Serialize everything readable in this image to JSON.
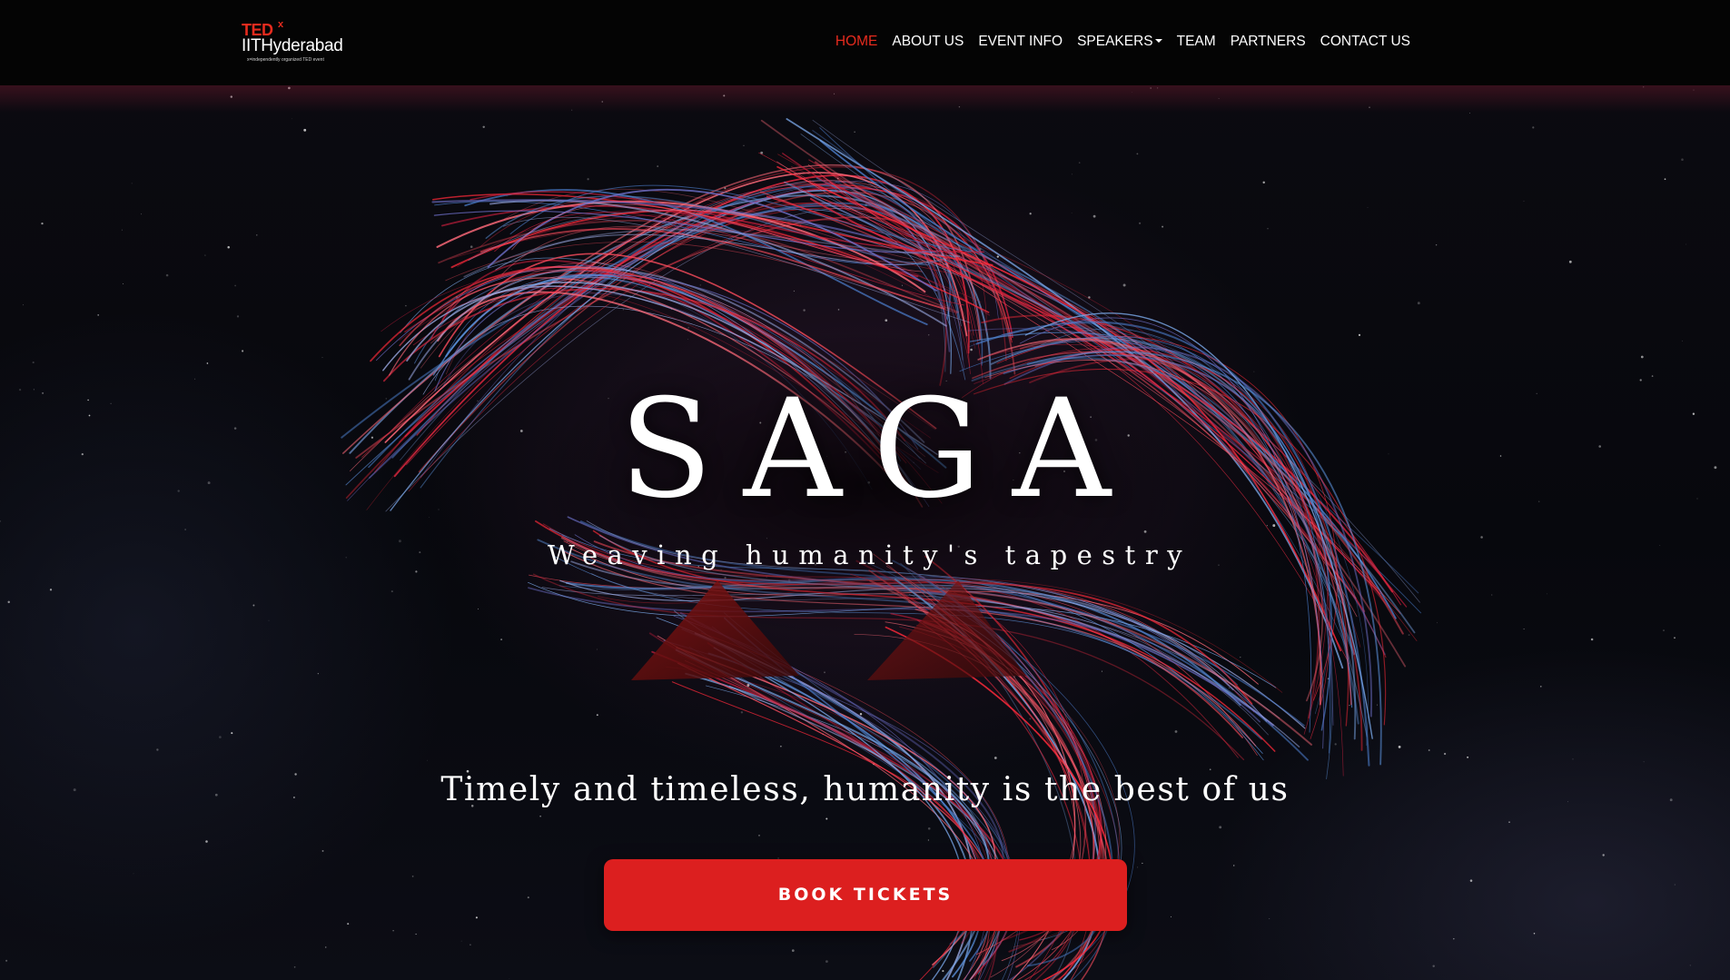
{
  "brand": {
    "ted": "TED",
    "x": "x",
    "name": "IITHyderabad",
    "tagline": "x=independently organized TED event"
  },
  "nav": {
    "items": [
      {
        "label": "HOME",
        "active": true
      },
      {
        "label": "ABOUT US"
      },
      {
        "label": "EVENT INFO"
      },
      {
        "label": "SPEAKERS",
        "dropdown": true
      },
      {
        "label": "TEAM"
      },
      {
        "label": "PARTNERS"
      },
      {
        "label": "CONTACT US"
      }
    ]
  },
  "hero": {
    "title": "SAGA",
    "subtitle": "Weaving humanity's tapestry",
    "tagline": "Timely and timeless, humanity is the best of us",
    "cta_label": "BOOK TICKETS"
  },
  "colors": {
    "accent": "#e62b1e",
    "cta": "#dc1f1f",
    "navbar": "#040404",
    "background": "#07080d"
  }
}
